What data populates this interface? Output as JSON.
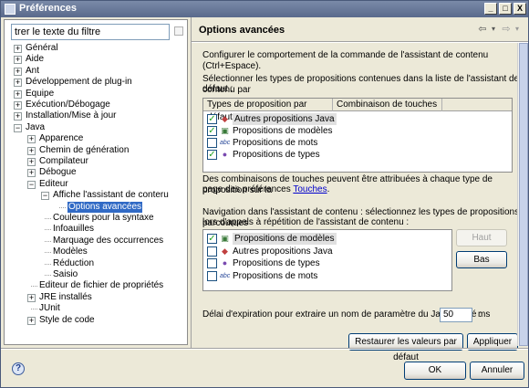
{
  "window": {
    "title": "Préférences",
    "min": "_",
    "max": "□",
    "close": "X"
  },
  "filter": {
    "value": "trer le texte du filtre"
  },
  "tree": [
    {
      "label": "Général",
      "level": 0,
      "exp": "+"
    },
    {
      "label": "Aide",
      "level": 0,
      "exp": "+"
    },
    {
      "label": "Ant",
      "level": 0,
      "exp": "+"
    },
    {
      "label": "Développement de plug-in",
      "level": 0,
      "exp": "+"
    },
    {
      "label": "Equipe",
      "level": 0,
      "exp": "+"
    },
    {
      "label": "Exécution/Débogage",
      "level": 0,
      "exp": "+"
    },
    {
      "label": "Installation/Mise à jour",
      "level": 0,
      "exp": "+"
    },
    {
      "label": "Java",
      "level": 0,
      "exp": "−"
    },
    {
      "label": "Apparence",
      "level": 1,
      "exp": "+"
    },
    {
      "label": "Chemin de génération",
      "level": 1,
      "exp": "+"
    },
    {
      "label": "Compilateur",
      "level": 1,
      "exp": "+"
    },
    {
      "label": "Débogue",
      "level": 1,
      "exp": "+"
    },
    {
      "label": "Editeur",
      "level": 1,
      "exp": "−"
    },
    {
      "label": "Affiche l'assistant de conteru",
      "level": 2,
      "exp": "−"
    },
    {
      "label": "Options avancées",
      "level": 3,
      "exp": "",
      "selected": true
    },
    {
      "label": "Couleurs pour la syntaxe",
      "level": 2,
      "exp": ""
    },
    {
      "label": "Infoauilles",
      "level": 2,
      "exp": ""
    },
    {
      "label": "Marquage des occurrences",
      "level": 2,
      "exp": ""
    },
    {
      "label": "Modèles",
      "level": 2,
      "exp": ""
    },
    {
      "label": "Réduction",
      "level": 2,
      "exp": ""
    },
    {
      "label": "Saisio",
      "level": 2,
      "exp": ""
    },
    {
      "label": "Editeur de fichier de propriétés",
      "level": 1,
      "exp": ""
    },
    {
      "label": "JRE installés",
      "level": 1,
      "exp": "+"
    },
    {
      "label": "JUnit",
      "level": 1,
      "exp": ""
    },
    {
      "label": "Style de code",
      "level": 1,
      "exp": "+"
    }
  ],
  "page": {
    "title": "Options avancées",
    "intro": "Configurer le comportement de la commande de l'assistant de contenu (Ctrl+Espace).",
    "select_text_1": "Sélectionner les types de propositions contenues dans la liste de l'assistant de contenu par",
    "select_text_2": "défaut :",
    "col1": "Types de proposition par défaut",
    "col2": "Combinaison de touches",
    "table1": [
      {
        "label": "Autres propositions Java",
        "checked": true,
        "icon": "java-proposals-icon",
        "hl": true
      },
      {
        "label": "Propositions de modèles",
        "checked": true,
        "icon": "templates-icon"
      },
      {
        "label": "Propositions de mots",
        "checked": false,
        "icon": "words-icon"
      },
      {
        "label": "Propositions de types",
        "checked": true,
        "icon": "types-icon"
      }
    ],
    "keys_text_1": "Des combinaisons de touches peuvent être attribuées à chaque type de proposition sur la",
    "keys_text_2_prefix": "page des préférences ",
    "keys_link": "Touches",
    "keys_text_2_suffix": ".",
    "nav_text_1": "Navigation dans l'assistant de contenu : sélectionnez les types de propositions parcourues",
    "nav_text_2": "lors d'appels à répétition de l'assistant de contenu :",
    "table2": [
      {
        "label": "Propositions de modèles",
        "checked": true,
        "icon": "templates-icon",
        "hl": true
      },
      {
        "label": "Autres propositions Java",
        "checked": false,
        "icon": "java-proposals-icon"
      },
      {
        "label": "Propositions de types",
        "checked": false,
        "icon": "types-icon"
      },
      {
        "label": "Propositions de mots",
        "checked": false,
        "icon": "words-icon"
      }
    ],
    "btn_up": "Haut",
    "btn_down": "Bas",
    "delay_label": "Délai d'expiration pour extraire un nom de paramètre du Javadoc lié :",
    "delay_value": "50",
    "delay_unit": "ms",
    "restore": "Restaurer les valeurs par défaut",
    "apply": "Appliquer"
  },
  "footer": {
    "ok": "OK",
    "cancel": "Annuler",
    "help": "?"
  }
}
